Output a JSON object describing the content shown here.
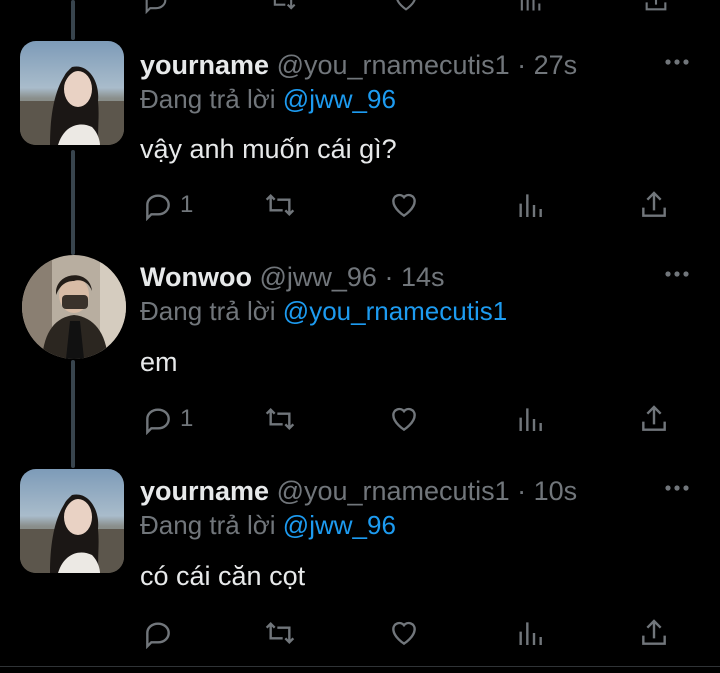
{
  "theme": {
    "background": "#000000",
    "text": "#e7e9ea",
    "muted": "#71767b",
    "link": "#1d9bf0",
    "thread_line": "#38444d"
  },
  "tweets": [
    {
      "display_name": "yourname",
      "handle": "@you_rnamecutis1",
      "separator": "·",
      "time": "27s",
      "reply_prefix": "Đang trả lời",
      "reply_to": "@jww_96",
      "text": "vậy anh muốn cái gì?",
      "reply_count": "1",
      "avatar_icon": "profile-photo-girl"
    },
    {
      "display_name": "Wonwoo",
      "handle": "@jww_96",
      "separator": "·",
      "time": "14s",
      "reply_prefix": "Đang trả lời",
      "reply_to": "@you_rnamecutis1",
      "text": "em",
      "reply_count": "1",
      "avatar_icon": "profile-photo-boy"
    },
    {
      "display_name": "yourname",
      "handle": "@you_rnamecutis1",
      "separator": "·",
      "time": "10s",
      "reply_prefix": "Đang trả lời",
      "reply_to": "@jww_96",
      "text": "có cái căn cọt",
      "reply_count": "",
      "avatar_icon": "profile-photo-girl"
    }
  ],
  "icons": {
    "reply": "reply-icon",
    "retweet": "retweet-icon",
    "like": "like-icon",
    "views": "views-icon",
    "share": "share-icon",
    "more": "more-icon"
  }
}
